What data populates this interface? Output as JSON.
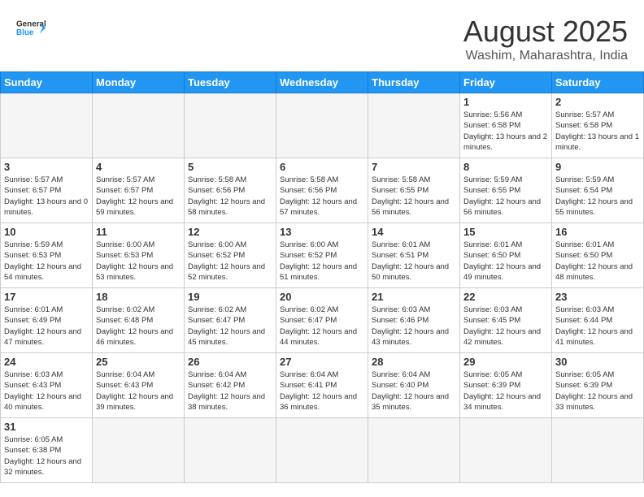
{
  "header": {
    "logo_general": "General",
    "logo_blue": "Blue",
    "month_title": "August 2025",
    "location": "Washim, Maharashtra, India"
  },
  "days_of_week": [
    "Sunday",
    "Monday",
    "Tuesday",
    "Wednesday",
    "Thursday",
    "Friday",
    "Saturday"
  ],
  "weeks": [
    [
      {
        "day": "",
        "empty": true
      },
      {
        "day": "",
        "empty": true
      },
      {
        "day": "",
        "empty": true
      },
      {
        "day": "",
        "empty": true
      },
      {
        "day": "",
        "empty": true
      },
      {
        "day": "1",
        "sunrise": "5:56 AM",
        "sunset": "6:58 PM",
        "daylight": "13 hours and 2 minutes."
      },
      {
        "day": "2",
        "sunrise": "5:57 AM",
        "sunset": "6:58 PM",
        "daylight": "13 hours and 1 minute."
      }
    ],
    [
      {
        "day": "3",
        "sunrise": "5:57 AM",
        "sunset": "6:57 PM",
        "daylight": "13 hours and 0 minutes."
      },
      {
        "day": "4",
        "sunrise": "5:57 AM",
        "sunset": "6:57 PM",
        "daylight": "12 hours and 59 minutes."
      },
      {
        "day": "5",
        "sunrise": "5:58 AM",
        "sunset": "6:56 PM",
        "daylight": "12 hours and 58 minutes."
      },
      {
        "day": "6",
        "sunrise": "5:58 AM",
        "sunset": "6:56 PM",
        "daylight": "12 hours and 57 minutes."
      },
      {
        "day": "7",
        "sunrise": "5:58 AM",
        "sunset": "6:55 PM",
        "daylight": "12 hours and 56 minutes."
      },
      {
        "day": "8",
        "sunrise": "5:59 AM",
        "sunset": "6:55 PM",
        "daylight": "12 hours and 56 minutes."
      },
      {
        "day": "9",
        "sunrise": "5:59 AM",
        "sunset": "6:54 PM",
        "daylight": "12 hours and 55 minutes."
      }
    ],
    [
      {
        "day": "10",
        "sunrise": "5:59 AM",
        "sunset": "6:53 PM",
        "daylight": "12 hours and 54 minutes."
      },
      {
        "day": "11",
        "sunrise": "6:00 AM",
        "sunset": "6:53 PM",
        "daylight": "12 hours and 53 minutes."
      },
      {
        "day": "12",
        "sunrise": "6:00 AM",
        "sunset": "6:52 PM",
        "daylight": "12 hours and 52 minutes."
      },
      {
        "day": "13",
        "sunrise": "6:00 AM",
        "sunset": "6:52 PM",
        "daylight": "12 hours and 51 minutes."
      },
      {
        "day": "14",
        "sunrise": "6:01 AM",
        "sunset": "6:51 PM",
        "daylight": "12 hours and 50 minutes."
      },
      {
        "day": "15",
        "sunrise": "6:01 AM",
        "sunset": "6:50 PM",
        "daylight": "12 hours and 49 minutes."
      },
      {
        "day": "16",
        "sunrise": "6:01 AM",
        "sunset": "6:50 PM",
        "daylight": "12 hours and 48 minutes."
      }
    ],
    [
      {
        "day": "17",
        "sunrise": "6:01 AM",
        "sunset": "6:49 PM",
        "daylight": "12 hours and 47 minutes."
      },
      {
        "day": "18",
        "sunrise": "6:02 AM",
        "sunset": "6:48 PM",
        "daylight": "12 hours and 46 minutes."
      },
      {
        "day": "19",
        "sunrise": "6:02 AM",
        "sunset": "6:47 PM",
        "daylight": "12 hours and 45 minutes."
      },
      {
        "day": "20",
        "sunrise": "6:02 AM",
        "sunset": "6:47 PM",
        "daylight": "12 hours and 44 minutes."
      },
      {
        "day": "21",
        "sunrise": "6:03 AM",
        "sunset": "6:46 PM",
        "daylight": "12 hours and 43 minutes."
      },
      {
        "day": "22",
        "sunrise": "6:03 AM",
        "sunset": "6:45 PM",
        "daylight": "12 hours and 42 minutes."
      },
      {
        "day": "23",
        "sunrise": "6:03 AM",
        "sunset": "6:44 PM",
        "daylight": "12 hours and 41 minutes."
      }
    ],
    [
      {
        "day": "24",
        "sunrise": "6:03 AM",
        "sunset": "6:43 PM",
        "daylight": "12 hours and 40 minutes."
      },
      {
        "day": "25",
        "sunrise": "6:04 AM",
        "sunset": "6:43 PM",
        "daylight": "12 hours and 39 minutes."
      },
      {
        "day": "26",
        "sunrise": "6:04 AM",
        "sunset": "6:42 PM",
        "daylight": "12 hours and 38 minutes."
      },
      {
        "day": "27",
        "sunrise": "6:04 AM",
        "sunset": "6:41 PM",
        "daylight": "12 hours and 36 minutes."
      },
      {
        "day": "28",
        "sunrise": "6:04 AM",
        "sunset": "6:40 PM",
        "daylight": "12 hours and 35 minutes."
      },
      {
        "day": "29",
        "sunrise": "6:05 AM",
        "sunset": "6:39 PM",
        "daylight": "12 hours and 34 minutes."
      },
      {
        "day": "30",
        "sunrise": "6:05 AM",
        "sunset": "6:39 PM",
        "daylight": "12 hours and 33 minutes."
      }
    ],
    [
      {
        "day": "31",
        "sunrise": "6:05 AM",
        "sunset": "6:38 PM",
        "daylight": "12 hours and 32 minutes."
      },
      {
        "day": "",
        "empty": true
      },
      {
        "day": "",
        "empty": true
      },
      {
        "day": "",
        "empty": true
      },
      {
        "day": "",
        "empty": true
      },
      {
        "day": "",
        "empty": true
      },
      {
        "day": "",
        "empty": true
      }
    ]
  ]
}
